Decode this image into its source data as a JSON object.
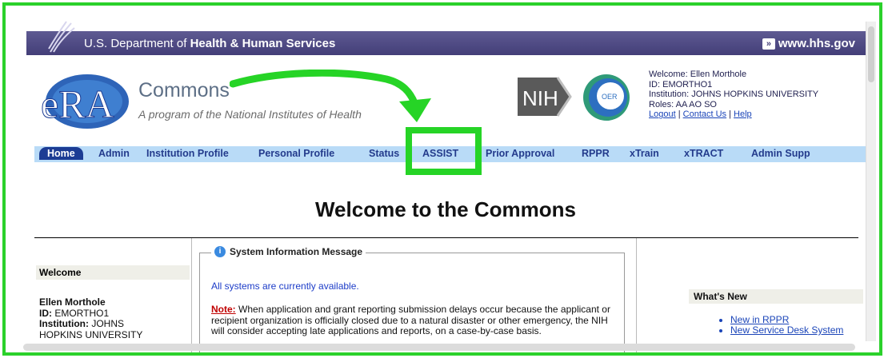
{
  "hhs_bar": {
    "department_prefix": "U.S. Department of",
    "department_name": "Health & Human Services",
    "link_text": "www.hhs.gov"
  },
  "branding": {
    "logo_text": "eRA",
    "title": "Commons",
    "subtitle": "A program of the National Institutes of Health",
    "nih_logo": "NIH",
    "oer_logo": "OER"
  },
  "user_info": {
    "welcome": "Welcome: Ellen Morthole",
    "id": "ID: EMORTHO1",
    "institution": "Institution: JOHNS HOPKINS UNIVERSITY",
    "roles": "Roles: AA AO SO",
    "logout": "Logout",
    "contact_us": "Contact Us",
    "help": "Help",
    "separator": "|"
  },
  "nav": {
    "items": [
      "Home",
      "Admin",
      "Institution Profile",
      "Personal Profile",
      "Status",
      "ASSIST",
      "Prior Approval",
      "RPPR",
      "xTrain",
      "xTRACT",
      "Admin Supp"
    ],
    "active": "Home",
    "highlighted": "ASSIST"
  },
  "page_title": "Welcome to the Commons",
  "left_panel": {
    "heading": "Welcome",
    "name": "Ellen Morthole",
    "id_label": "ID:",
    "id_value": "EMORTHO1",
    "institution_label": "Institution:",
    "institution_value_line1": "JOHNS",
    "institution_value_line2": "HOPKINS UNIVERSITY"
  },
  "system_message": {
    "legend": "System Information Message",
    "status": "All systems are currently available.",
    "note_label": "Note:",
    "note_text": "When application and grant reporting submission delays occur because the applicant or recipient organization is officially closed due to a natural disaster or other emergency, the NIH will consider accepting late applications and reports, on a case-by-case basis."
  },
  "whats_new": {
    "heading": "What's New",
    "items": [
      "New in RPPR",
      "New Service Desk System"
    ]
  },
  "colors": {
    "highlight_green": "#26d426",
    "hhs_bar": "#4a4580",
    "nav_bg": "#b9dbf7",
    "link_blue": "#1a44b8"
  }
}
